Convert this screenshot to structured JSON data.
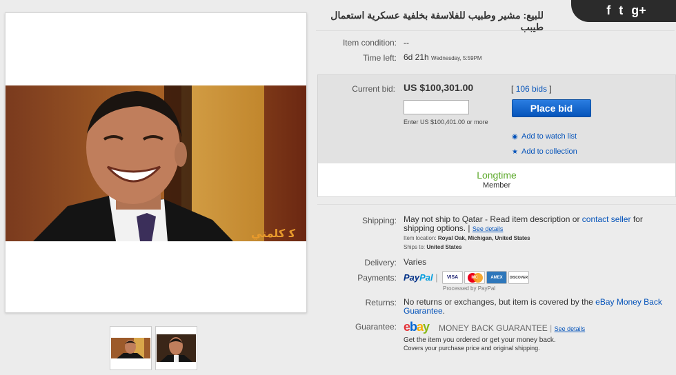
{
  "listing": {
    "title": "للبيع: مشير وطبيب للفلاسفة بخلفية عسكرية استعمال طيبب",
    "condition_label": "Item condition:",
    "condition_value": "--",
    "time_label": "Time left:",
    "time_value": "6d 21h",
    "time_detail": "Wednesday, 5:59PM"
  },
  "bid": {
    "label": "Current bid:",
    "price": "US $100,301.00",
    "bids_open": "[",
    "bids_link": "106 bids",
    "bids_close": "]",
    "input_value": "",
    "hint": "Enter US $100,401.00 or more",
    "place_bid": "Place bid",
    "watch": "Add to watch list",
    "collection": "Add to collection",
    "longtime": "Longtime",
    "member": "Member"
  },
  "shipping": {
    "label": "Shipping:",
    "text_a": "May not ship to Qatar - Read item description or ",
    "contact": "contact seller",
    "text_b": " for shipping",
    "text_c": "options. |",
    "see_details": "See details",
    "loc_label": "Item location:",
    "loc_value": "Royal Oak, Michigan, United States",
    "ships_label": "Ships to:",
    "ships_value": "United States"
  },
  "delivery": {
    "label": "Delivery:",
    "value": "Varies"
  },
  "payments": {
    "label": "Payments:",
    "paypal_a": "Pay",
    "paypal_b": "Pal",
    "sep": "|",
    "cards": [
      "VISA",
      "MC",
      "AMEX",
      "DISCOVER"
    ],
    "processed": "Processed by PayPal"
  },
  "returns": {
    "label": "Returns:",
    "text_a": "No returns or exchanges, but item is covered by the ",
    "link_a": "eBay Money Back",
    "link_b": "Guarantee",
    "text_b": "."
  },
  "guarantee": {
    "label": "Guarantee:",
    "ebay": [
      "e",
      "b",
      "a",
      "y"
    ],
    "mbg": "MONEY BACK GUARANTEE",
    "sep": "|",
    "see_details": "See details",
    "line1": "Get the item you ordered or get your money back.",
    "line2": "Covers your purchase price and original shipping."
  },
  "photo": {
    "watermark": "ﮐ كلمتي"
  },
  "social": {
    "facebook": "f",
    "twitter": "t",
    "gplus": "g+"
  },
  "colors": {
    "link": "#0654ba",
    "button": "#0654ba",
    "green": "#5ba829"
  }
}
